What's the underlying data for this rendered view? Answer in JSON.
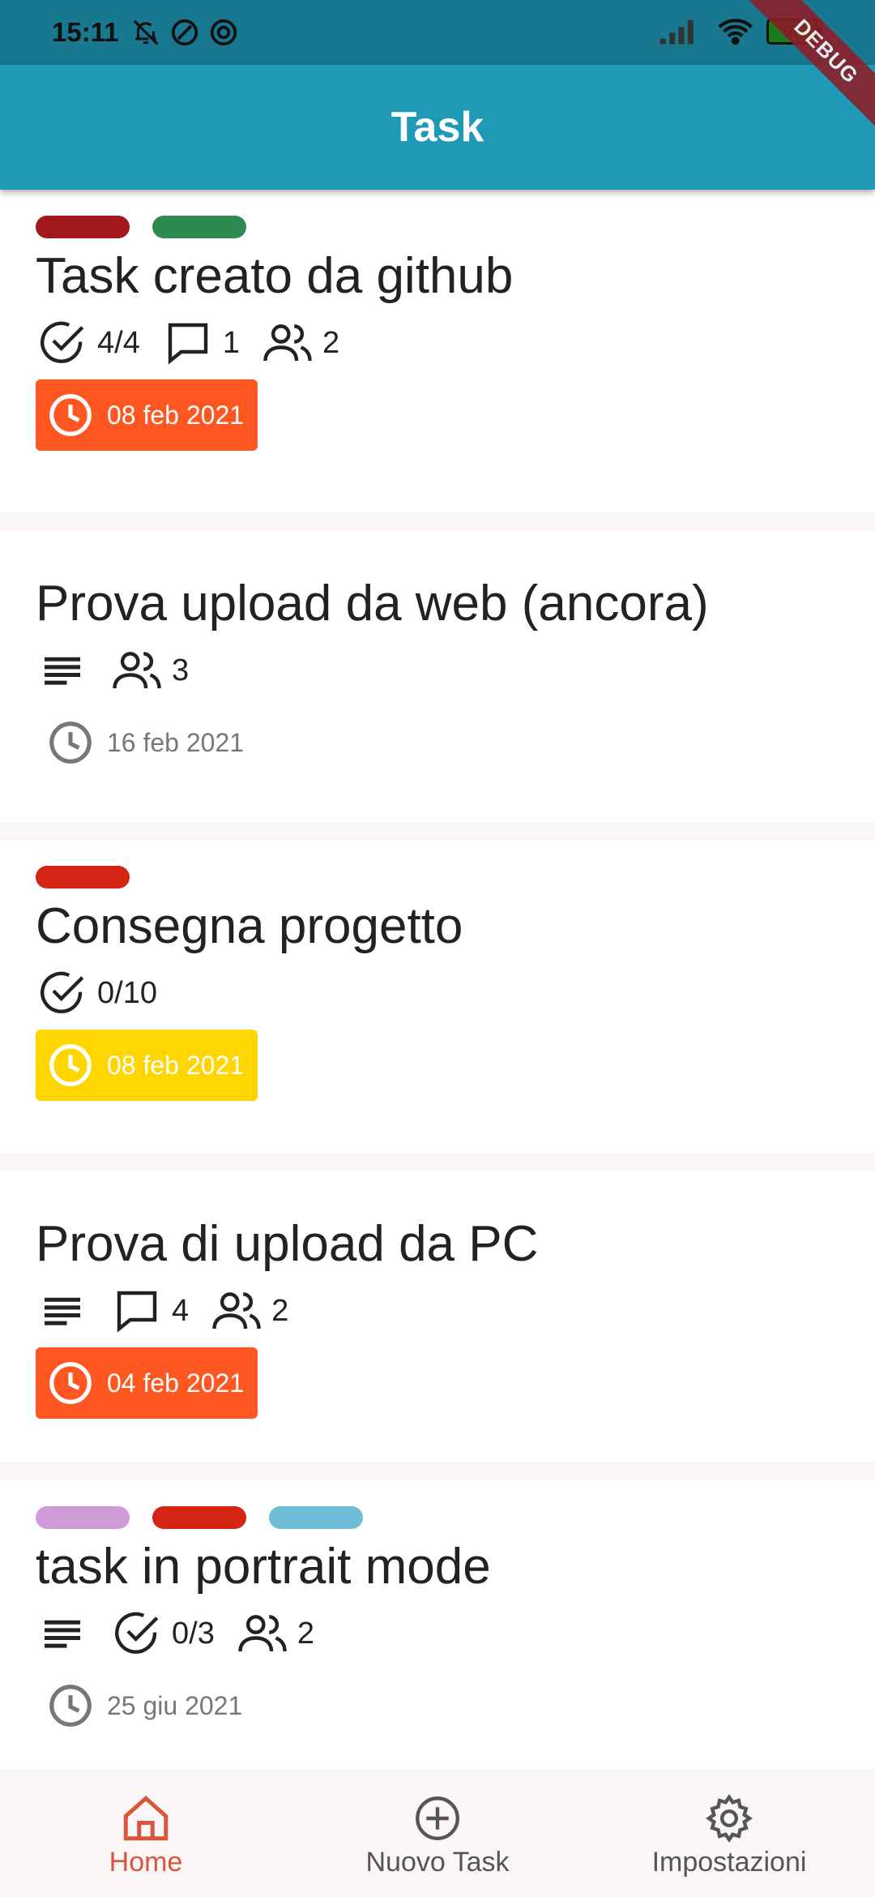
{
  "status_bar": {
    "time": "15:11",
    "battery": "97"
  },
  "debug_banner": "DEBUG",
  "app_bar": {
    "title": "Task"
  },
  "tasks": [
    {
      "labels": [
        "#a3181d",
        "#2c8a52"
      ],
      "title": "Task creato da github",
      "checklist": "4/4",
      "comments": "1",
      "members": "2",
      "due": "08 feb 2021",
      "due_color": "#ff5722"
    },
    {
      "labels": [],
      "title": "Prova upload da web (ancora)",
      "members": "3",
      "due": "16 feb 2021"
    },
    {
      "labels": [
        "#d32414"
      ],
      "title": "Consegna progetto",
      "checklist": "0/10",
      "due": "08 feb 2021",
      "due_color": "#ffd600"
    },
    {
      "labels": [],
      "title": "Prova di upload da PC",
      "comments": "4",
      "members": "2",
      "due": "04 feb 2021",
      "due_color": "#ff5722"
    },
    {
      "labels": [
        "#cf9ad8",
        "#d32414",
        "#6fbcd6"
      ],
      "title": "task in portrait mode",
      "checklist": "0/3",
      "members": "2",
      "due": "25 giu 2021"
    }
  ],
  "bottom_nav": {
    "home": "Home",
    "new_task": "Nuovo Task",
    "settings": "Impostazioni"
  },
  "colors": {
    "primary": "#1e9ab6",
    "status_bar": "#17788f",
    "accent": "#d9553b"
  }
}
